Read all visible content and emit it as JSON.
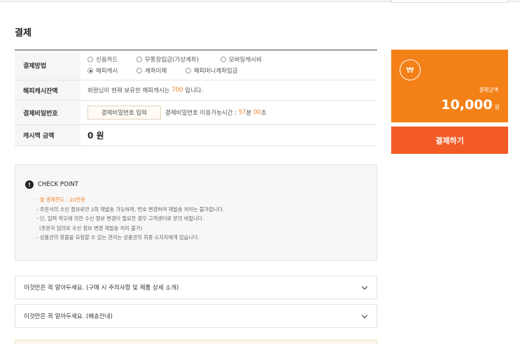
{
  "page_title": "결제",
  "payment": {
    "method_label": "결제방법",
    "methods_row1": [
      {
        "label": "신용카드",
        "selected": false
      },
      {
        "label": "무통장입금(가상계좌)",
        "selected": false
      },
      {
        "label": "모바일캐시비",
        "selected": false
      }
    ],
    "methods_row2": [
      {
        "label": "해피캐시",
        "selected": true
      },
      {
        "label": "계좌이체",
        "selected": false
      },
      {
        "label": "해피머니계좌입금",
        "selected": false
      }
    ],
    "balance_label": "해피캐시잔액",
    "balance_text_before": "회원님이 현재 보유한 해피캐시는 ",
    "balance_value": "700",
    "balance_text_after": " 입니다.",
    "password_label": "결제비밀번호",
    "password_placeholder": "결제비밀번호 입력",
    "password_time_text": "결제비밀번호 이용가능시간 : ",
    "password_minutes": "57",
    "password_minutes_unit": "분",
    "password_seconds": "00",
    "password_seconds_unit": "초",
    "cashback_label": "캐시백 금액",
    "cashback_value": "0 원"
  },
  "checkpoint": {
    "icon": "exclamation-icon",
    "title": "CHECK POINT",
    "limit": "- 월 결제한도 : 10만원",
    "lines": [
      "- 주문서의 수신 정보로만 2회 재발송 가능하며, 번호 변경하여 재발송 처리는 불가합니다.",
      "- 단, 입력 착오에 의한 수신 정보 변경이 필요한 경우 고객센터로 문의 바랍니다.",
      "(주문자 임의로 수신 정보 변경 재발송 처리 불가)",
      "- 상품권의 환불을 요청할 수 있는 권리는 상품권의 최종 소지자에게 있습니다."
    ]
  },
  "accordions": [
    {
      "title": "이것만은 꼭 알아두세요. (구매 시 주의사항 및 제품 상세 소개)",
      "icon": "chevron-down-icon"
    },
    {
      "title": "이것만은 꼭 알아두세요. (배송안내)",
      "icon": "chevron-down-icon"
    }
  ],
  "summary": {
    "won_icon": "won-icon",
    "won_symbol": "₩",
    "amount_label": "결제금액",
    "amount_value": "10,000",
    "amount_unit": "원",
    "pay_button": "결제하기"
  },
  "colors": {
    "highlight": "#f07f1c",
    "amount_box": "#f38118",
    "pay_button": "#f25a26"
  }
}
